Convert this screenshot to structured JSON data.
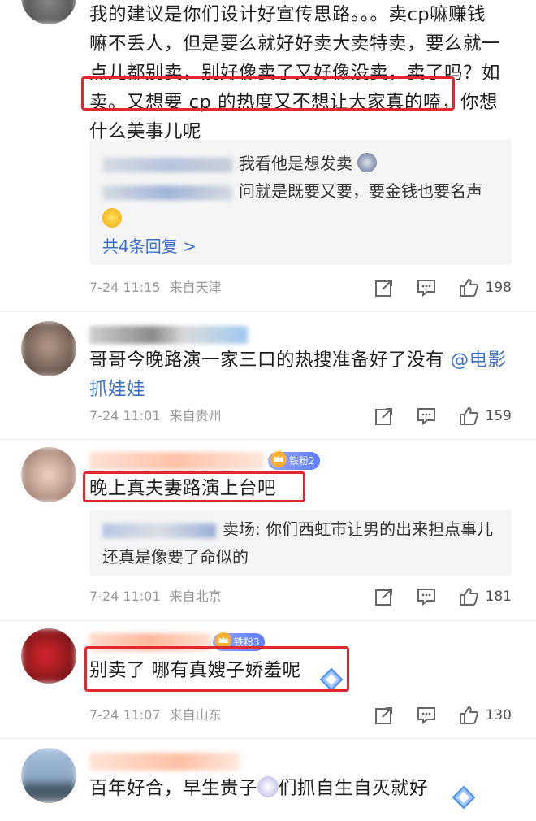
{
  "comments": [
    {
      "text_lines": [
        "我的建议是你们设计好宣传思路。。。卖cp嘛赚钱",
        "嘛不丢人，但是要么就好好卖大卖特卖，要么就一",
        "点儿都别卖，别好像卖了又好像没卖，卖了吗？如",
        "卖。又想要 cp 的热度又不想让大家真的嗑，你想",
        "什么美事儿呢"
      ],
      "highlight_text": "卖。又想要 cp 的热度又不想让大家真的嗑，",
      "replies": [
        {
          "text": "我看他是想发卖",
          "emoji": "crying-face-icon"
        },
        {
          "text": "问就是既要又要，要金钱也要名声",
          "emoji": "laughing-face-icon"
        }
      ],
      "more_replies": "共4条回复 >",
      "date": "7-24 11:15",
      "location": "来自天津",
      "likes": "198"
    },
    {
      "text_pre": "哥哥今晚路演一家三口的热搜准备好了没有 ",
      "mention": "@电影抓娃娃",
      "date": "7-24 11:01",
      "location": "来自贵州",
      "likes": "159"
    },
    {
      "badge": "铁粉2",
      "text": "晚上真夫妻路演上台吧",
      "reply_text": "卖场: 你们西虹市让男的出来担点事儿还真是像要了命似的",
      "date": "7-24 11:01",
      "location": "来自北京",
      "likes": "181"
    },
    {
      "badge": "铁粉3",
      "text": "别卖了 哪有真嫂子娇羞呢",
      "date": "7-24 11:07",
      "location": "来自山东",
      "likes": "130"
    },
    {
      "text_a": "百年好合，早生贵子",
      "text_b": "们抓自生自灭就好"
    }
  ],
  "colors": {
    "highlight": "#e0282e",
    "link": "#3d71c9",
    "meta": "#999999"
  }
}
